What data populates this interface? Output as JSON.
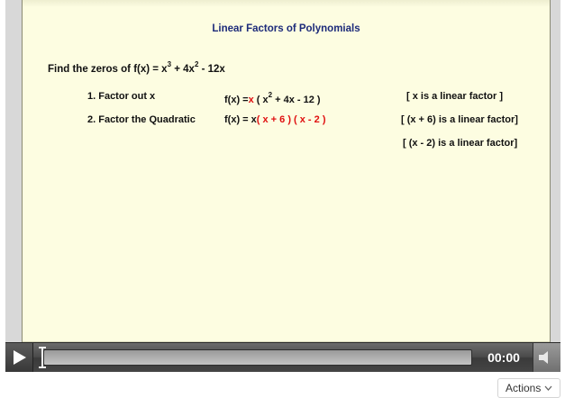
{
  "slide": {
    "title": "Linear Factors of Polynomials",
    "problem": {
      "prefix": "Find the zeros of f(x) = x",
      "exp1": "3",
      "mid": " + 4x",
      "exp2": "2",
      "suffix": " - 12x"
    },
    "steps": [
      {
        "label": "1. Factor out x",
        "expr_prefix": "f(x) =",
        "expr_red": "x",
        "expr_rest": " ( x",
        "expr_exp": "2",
        "expr_tail": " + 4x - 12 )",
        "note": "[ x is a linear factor ]"
      },
      {
        "label": "2. Factor the Quadratic",
        "expr_prefix": "f(x) = x",
        "expr_red": "( x + 6 ) ( x - 2 )",
        "note": "[ (x + 6) is a linear factor]"
      }
    ],
    "extra_note": "[ (x - 2) is a linear factor]"
  },
  "player": {
    "time": "00:00",
    "progress": 0,
    "play_icon": "play-icon",
    "volume_icon": "speaker-icon"
  },
  "actions": {
    "label": "Actions",
    "icon": "chevron-down-icon"
  },
  "colors": {
    "slide_background": "#fdfde1",
    "title_color": "#1d2b7a",
    "highlight_red": "#e01010"
  }
}
